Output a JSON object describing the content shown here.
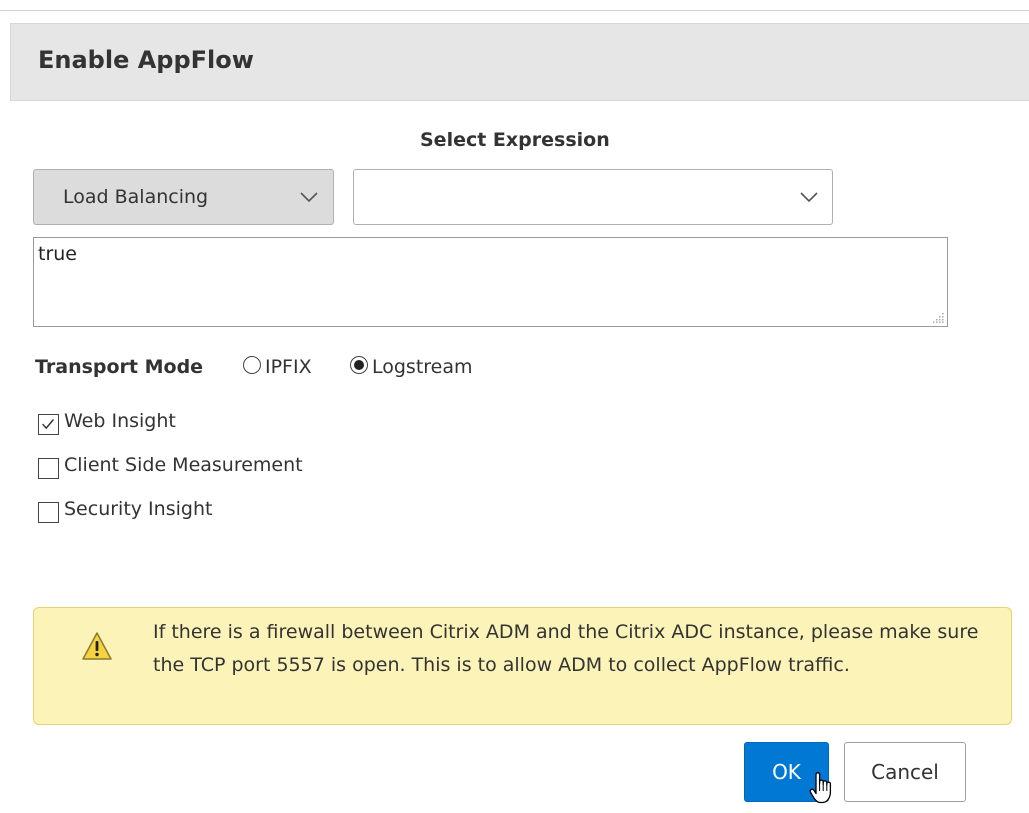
{
  "dialog": {
    "title": "Enable AppFlow"
  },
  "expression": {
    "label": "Select Expression",
    "category_value": "Load Balancing",
    "expression_value": "",
    "text": "true"
  },
  "transport": {
    "label": "Transport Mode",
    "options": [
      {
        "label": "IPFIX",
        "selected": false
      },
      {
        "label": "Logstream",
        "selected": true
      }
    ]
  },
  "insights": [
    {
      "label": "Web Insight",
      "checked": true
    },
    {
      "label": "Client Side Measurement",
      "checked": false
    },
    {
      "label": "Security Insight",
      "checked": false
    }
  ],
  "warning": {
    "icon": "warning-icon",
    "text": "If there is a firewall between Citrix ADM and the Citrix ADC instance, please make sure the TCP port 5557 is open. This is to allow ADM to collect AppFlow traffic."
  },
  "buttons": {
    "ok": "OK",
    "cancel": "Cancel"
  },
  "colors": {
    "primary": "#0078d4",
    "warning_bg": "#fbf3b8",
    "header_bg": "#e6e6e6"
  }
}
